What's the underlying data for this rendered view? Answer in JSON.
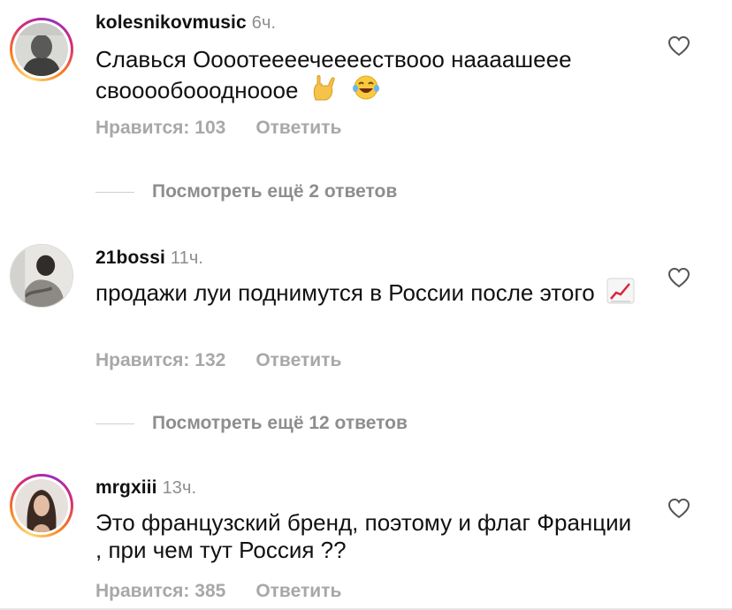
{
  "comments": [
    {
      "username": "kolesnikovmusic",
      "time": "6ч.",
      "text": "Славься Оооотеееечеееествооо наааашеее свооообоооднoooe",
      "emojis": [
        "love-you-gesture-emoji",
        "laughing-tears-emoji"
      ],
      "likes": "Нравится: 103",
      "reply": "Ответить",
      "more_replies": "Посмотреть ещё 2 ответов",
      "story_ring": true
    },
    {
      "username": "21bossi",
      "time": "11ч.",
      "text": "продажи луи поднимутся в России после этого",
      "emojis": [
        "chart-increasing-emoji"
      ],
      "likes": "Нравится: 132",
      "reply": "Ответить",
      "more_replies": "Посмотреть ещё 12 ответов",
      "story_ring": false
    },
    {
      "username": "mrgxiii",
      "time": "13ч.",
      "text": "Это французский бренд, поэтому и флаг Франции , при чем тут Россия ??",
      "emojis": [],
      "likes": "Нравится: 385",
      "reply": "Ответить",
      "story_ring": true
    }
  ],
  "icons": {
    "like": "heart-icon"
  },
  "colors": {
    "muted_text": "#8e8e8e",
    "action_text": "#a8a8a8",
    "primary_text": "#111111"
  }
}
